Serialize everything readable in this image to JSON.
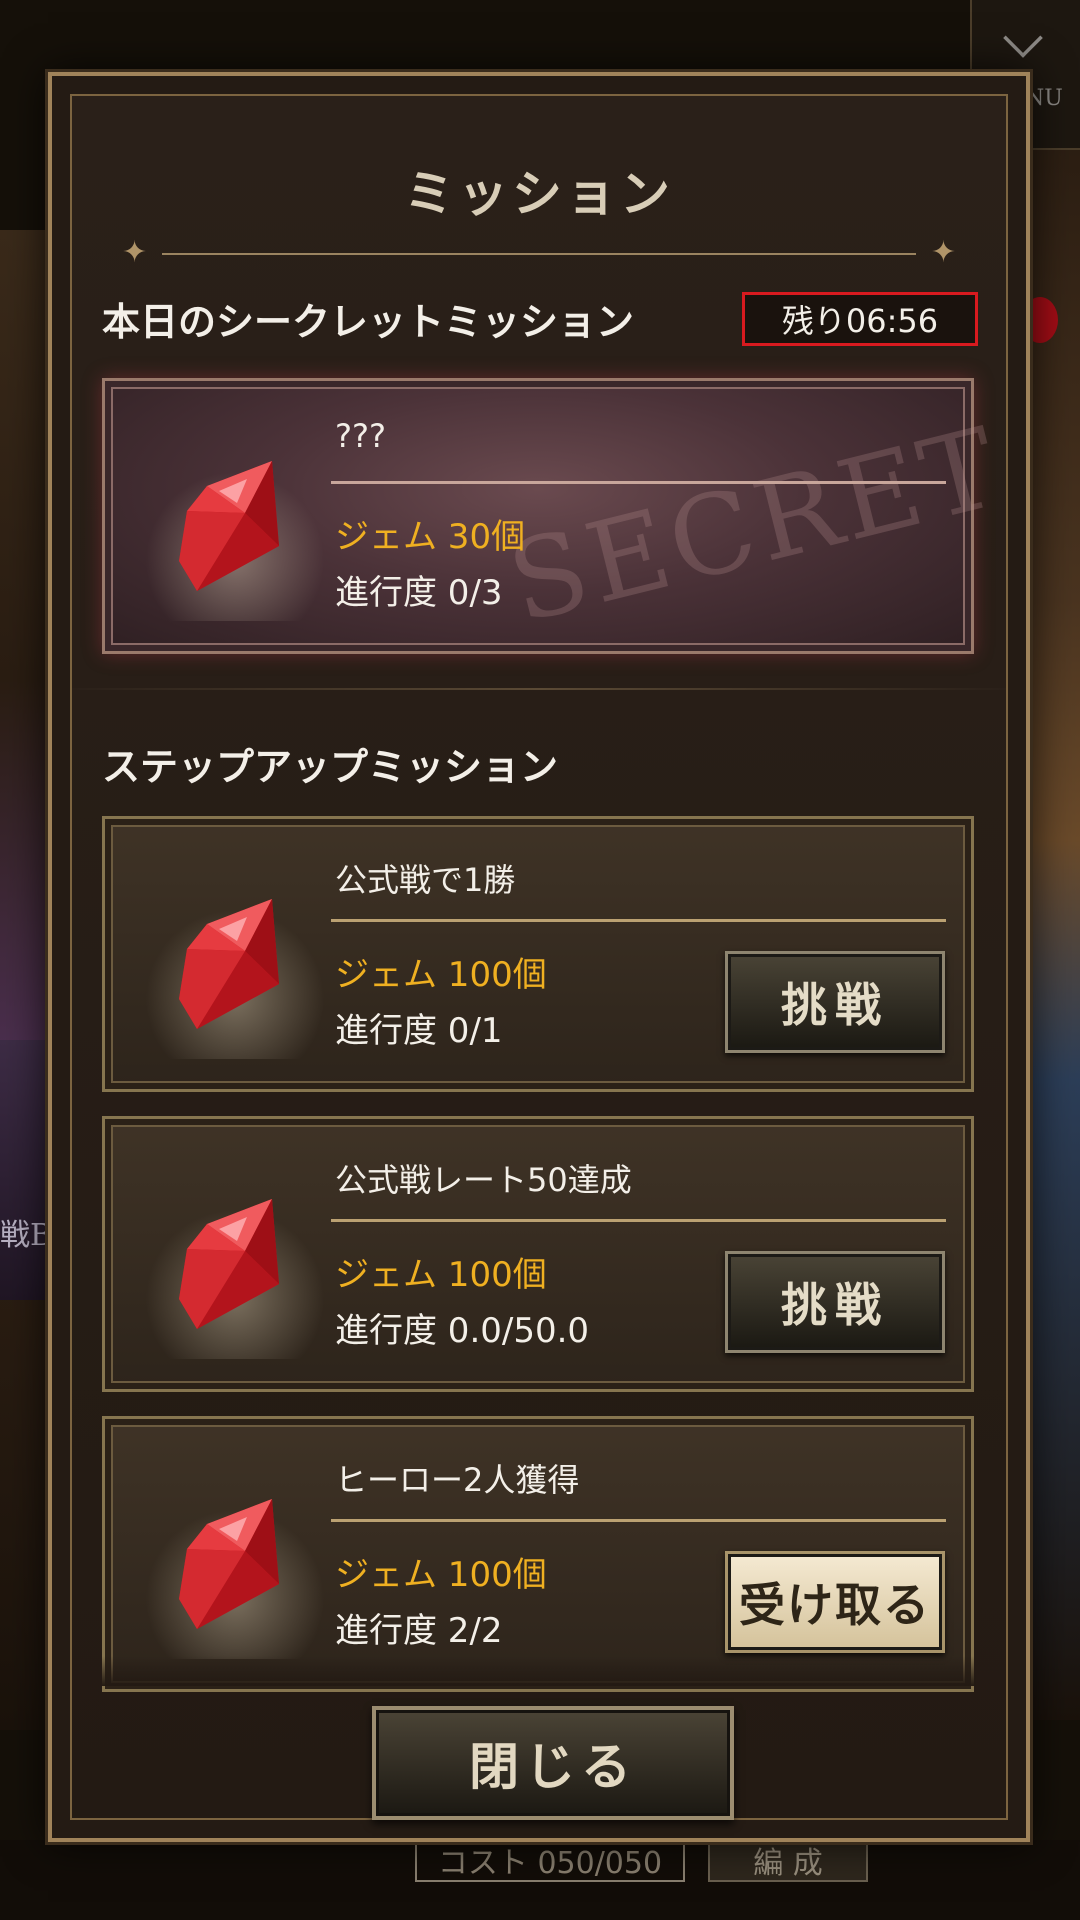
{
  "background": {
    "menu_label": "NU",
    "left_card_text": "戦BC",
    "cost_text": "コスト 050/050",
    "edit_label": "編 成"
  },
  "modal": {
    "title": "ミッション",
    "secret_section": {
      "heading": "本日のシークレットミッション",
      "timer": "残り06:56",
      "watermark": "SECRET",
      "mission": {
        "name": "???",
        "reward": "ジェム 30個",
        "progress": "進行度 0/3"
      }
    },
    "stepup_section": {
      "heading": "ステップアップミッション",
      "missions": [
        {
          "name": "公式戦で1勝",
          "reward": "ジェム 100個",
          "progress": "進行度 0/1",
          "button": "挑戦"
        },
        {
          "name": "公式戦レート50達成",
          "reward": "ジェム 100個",
          "progress": "進行度 0.0/50.0",
          "button": "挑戦"
        },
        {
          "name": "ヒーロー2人獲得",
          "reward": "ジェム 100個",
          "progress": "進行度 2/2",
          "button": "受け取る"
        }
      ]
    },
    "close_label": "閉じる"
  },
  "colors": {
    "reward_text": "#efb021",
    "timer_border": "#d81a1f",
    "panel_border": "#a0835a",
    "gem": "#d9262c"
  },
  "icons": {
    "reward": "red-gem-icon",
    "ornament": "ornamental-divider"
  }
}
